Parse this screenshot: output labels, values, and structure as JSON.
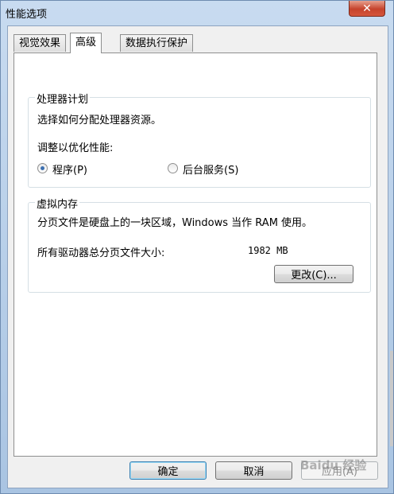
{
  "window": {
    "title": "性能选项",
    "close_glyph": "✕"
  },
  "tabs": [
    {
      "label": "视觉效果"
    },
    {
      "label": "高级"
    },
    {
      "label": "数据执行保护"
    }
  ],
  "processor_group": {
    "title": "处理器计划",
    "description": "选择如何分配处理器资源。",
    "adjust_label": "调整以优化性能:",
    "options": [
      {
        "label": "程序(P)",
        "checked": true
      },
      {
        "label": "后台服务(S)",
        "checked": false
      }
    ]
  },
  "virtual_memory_group": {
    "title": "虚拟内存",
    "description": "分页文件是硬盘上的一块区域，Windows 当作 RAM 使用。",
    "total_label": "所有驱动器总分页文件大小:",
    "total_value": "1982 MB",
    "change_button": "更改(C)..."
  },
  "footer": {
    "ok_button": "确定",
    "cancel_button": "取消",
    "apply_button": "应用(A)"
  },
  "watermark": {
    "text": "Baidu 经验"
  },
  "colors": {
    "annotation_red": "#e02020",
    "accent": "#3c6fb0"
  }
}
